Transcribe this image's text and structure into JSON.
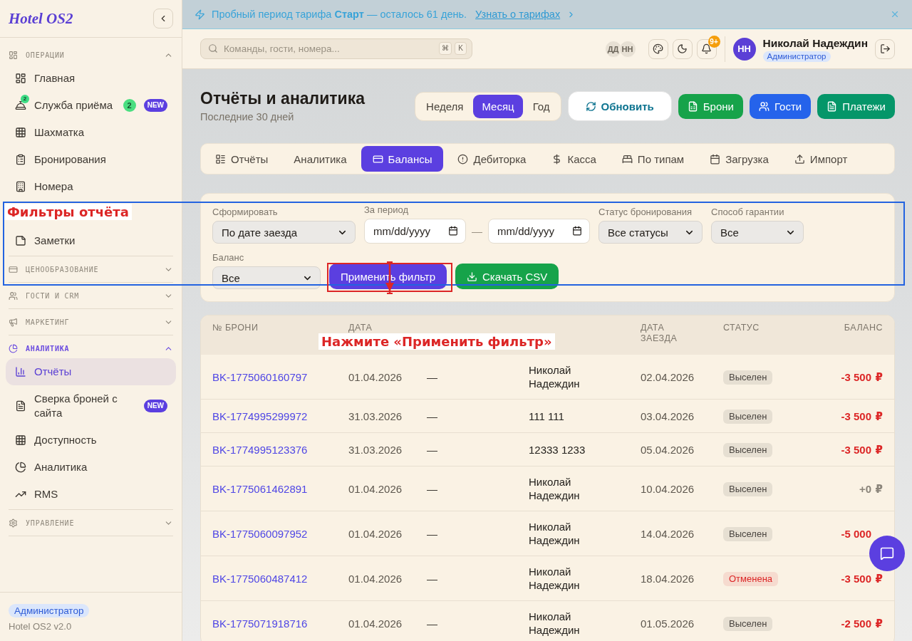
{
  "sidebar": {
    "logo": "Hotel OS2",
    "sections": [
      {
        "title": "ОПЕРАЦИИ",
        "expanded": true,
        "selected": false,
        "items": [
          {
            "label": "Главная",
            "selected": false
          },
          {
            "label": "Служба приёма",
            "selected": false,
            "icon_badge": "2",
            "count": "2",
            "badge": "NEW"
          },
          {
            "label": "Шахматка",
            "selected": false
          },
          {
            "label": "Бронирования",
            "selected": false
          },
          {
            "label": "Номера",
            "selected": false
          },
          {
            "label": "Заметки",
            "selected": false
          }
        ]
      },
      {
        "title": "ЦЕНООБРАЗОВАНИЕ",
        "expanded": false,
        "selected": false
      },
      {
        "title": "ГОСТИ И CRM",
        "expanded": false,
        "selected": false
      },
      {
        "title": "МАРКЕТИНГ",
        "expanded": false,
        "selected": false
      },
      {
        "title": "АНАЛИТИКА",
        "expanded": true,
        "selected": true,
        "items": [
          {
            "label": "Отчёты",
            "selected": true
          },
          {
            "label": "Сверка броней с сайта",
            "selected": false,
            "badge": "NEW"
          },
          {
            "label": "Доступность",
            "selected": false
          },
          {
            "label": "Аналитика",
            "selected": false
          },
          {
            "label": "RMS",
            "selected": false
          }
        ]
      },
      {
        "title": "УПРАВЛЕНИЕ",
        "expanded": false,
        "selected": false
      }
    ],
    "footer": {
      "role": "Администратор",
      "version": "Hotel OS2 v2.0"
    }
  },
  "banner": {
    "message": "Пробный период тарифа **Старт** — осталось 61 день.",
    "link": "Узнать о тарифах"
  },
  "header": {
    "search": {
      "placeholder": "Команды, гости, номера...",
      "keys": [
        "⌘",
        "K"
      ]
    },
    "presence": [
      "ДД",
      "НН"
    ],
    "notifications": "9+",
    "user": {
      "initials": "НН",
      "name": "Николай Надеждин",
      "role": "Администратор"
    }
  },
  "page": {
    "title": "Отчёты и аналитика",
    "subtitle": "Последние 30 дней",
    "periods": [
      {
        "label": "Неделя",
        "selected": false
      },
      {
        "label": "Месяц",
        "selected": true
      },
      {
        "label": "Год",
        "selected": false
      }
    ],
    "actions": [
      {
        "label": "Обновить",
        "kind": "outline"
      },
      {
        "label": "Брони",
        "kind": "filled",
        "color": "#16a34a"
      },
      {
        "label": "Гости",
        "kind": "filled",
        "color": "#2563eb"
      },
      {
        "label": "Платежи",
        "kind": "filled",
        "color": "#059669"
      }
    ]
  },
  "tabs": [
    {
      "label": "Отчёты",
      "selected": false
    },
    {
      "label": "Аналитика",
      "selected": false
    },
    {
      "label": "Балансы",
      "selected": true
    },
    {
      "label": "Дебиторка",
      "selected": false
    },
    {
      "label": "Касса",
      "selected": false
    },
    {
      "label": "По типам",
      "selected": false
    },
    {
      "label": "Загрузка",
      "selected": false
    },
    {
      "label": "Импорт",
      "selected": false
    }
  ],
  "filters": {
    "fields": [
      {
        "kind": "select",
        "label": "Сформировать",
        "value": "По дате заезда"
      },
      {
        "kind": "date_range",
        "label": "За период",
        "from_placeholder": "mm/dd/yyyy",
        "separator": "—",
        "to_placeholder": "mm/dd/yyyy"
      },
      {
        "kind": "select",
        "label": "Статус бронирования",
        "value": "Все статусы"
      },
      {
        "kind": "select",
        "label": "Способ гарантии",
        "value": "Все"
      },
      {
        "kind": "select",
        "label": "Баланс",
        "value": "Все"
      }
    ],
    "buttons": [
      {
        "label": "Применить фильтр",
        "kind": "primary"
      },
      {
        "label": "Скачать CSV",
        "kind": "download"
      }
    ]
  },
  "table": {
    "columns": {
      "booking_no": "№ БРОНИ",
      "date": "ДАТА",
      "check_in": "ДАТА ЗАЕЗДА",
      "status": "СТАТУС",
      "balance": "БАЛАНС"
    },
    "rows": [
      {
        "booking_no": "BK-1775060160797",
        "date": "01.04.2026",
        "column_3": "—",
        "column_4": "Николай Надеждин",
        "check_in": "02.04.2026",
        "status": {
          "label": "Выселен",
          "color": "#4a4540"
        },
        "balance": {
          "amount": "-3 500",
          "currency": "₽",
          "color": "#dc2626"
        }
      },
      {
        "booking_no": "BK-1774995299972",
        "date": "31.03.2026",
        "column_3": "—",
        "column_4": "111 111",
        "check_in": "03.04.2026",
        "status": {
          "label": "Выселен",
          "color": "#4a4540"
        },
        "balance": {
          "amount": "-3 500",
          "currency": "₽",
          "color": "#dc2626"
        }
      },
      {
        "booking_no": "BK-1774995123376",
        "date": "31.03.2026",
        "column_3": "—",
        "column_4": "12333 1233",
        "check_in": "05.04.2026",
        "status": {
          "label": "Выселен",
          "color": "#4a4540"
        },
        "balance": {
          "amount": "-3 500",
          "currency": "₽",
          "color": "#dc2626"
        }
      },
      {
        "booking_no": "BK-1775061462891",
        "date": "01.04.2026",
        "column_3": "—",
        "column_4": "Николай Надеждин",
        "check_in": "10.04.2026",
        "status": {
          "label": "Выселен",
          "color": "#4a4540"
        },
        "balance": {
          "amount": "+0",
          "currency": "₽",
          "color": "#8a847a"
        }
      },
      {
        "booking_no": "BK-1775060097952",
        "date": "01.04.2026",
        "column_3": "—",
        "column_4": "Николай Надеждин",
        "check_in": "14.04.2026",
        "status": {
          "label": "Выселен",
          "color": "#4a4540"
        },
        "balance": {
          "amount": "-5 000",
          "color": "#dc2626"
        }
      },
      {
        "booking_no": "BK-1775060487412",
        "date": "01.04.2026",
        "column_3": "—",
        "column_4": "Николай Надеждин",
        "check_in": "18.04.2026",
        "status": {
          "label": "Отменена",
          "color": "#dc2626"
        },
        "balance": {
          "amount": "-3 500",
          "currency": "₽",
          "color": "#dc2626"
        }
      },
      {
        "booking_no": "BK-1775071918716",
        "date": "01.04.2026",
        "column_3": "—",
        "column_4": "Николай Надеждин",
        "check_in": "01.05.2026",
        "status": {
          "label": "Выселен",
          "color": "#4a4540"
        },
        "balance": {
          "amount": "-2 500",
          "currency": "₽",
          "color": "#dc2626"
        }
      }
    ]
  },
  "annotations": [
    {
      "kind": "frame",
      "label": "Фильтры отчёта"
    },
    {
      "kind": "highlight"
    },
    {
      "kind": "arrow"
    },
    {
      "kind": "callout",
      "label": "Нажмите «Применить фильтр»"
    }
  ]
}
